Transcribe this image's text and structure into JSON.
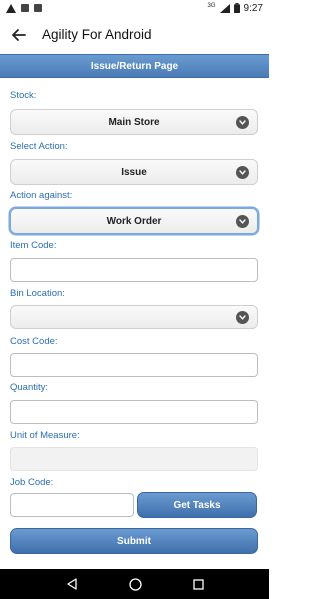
{
  "status_bar": {
    "time": "9:27",
    "signal": "3G",
    "icons": [
      "warning-icon",
      "notification-icon",
      "sd-card-icon",
      "signal-icon",
      "battery-icon"
    ]
  },
  "app_bar": {
    "title": "Agility For Android",
    "back_icon": "arrow-back-icon"
  },
  "page_header": "Issue/Return Page",
  "form": {
    "stock": {
      "label": "Stock:",
      "value": "Main Store"
    },
    "select_action": {
      "label": "Select Action:",
      "value": "Issue"
    },
    "action_against": {
      "label": "Action against:",
      "value": "Work Order"
    },
    "item_code": {
      "label": "Item Code:",
      "value": ""
    },
    "bin_location": {
      "label": "Bin Location:",
      "value": ""
    },
    "cost_code": {
      "label": "Cost Code:",
      "value": ""
    },
    "quantity": {
      "label": "Quantity:",
      "value": ""
    },
    "unit_of_measure": {
      "label": "Unit of Measure:",
      "value": ""
    },
    "job_code": {
      "label": "Job Code:",
      "value": ""
    },
    "get_tasks_label": "Get Tasks",
    "submit_label": "Submit"
  },
  "nav_bar": {
    "icons": [
      "back-triangle-icon",
      "home-circle-icon",
      "recents-square-icon"
    ]
  },
  "colors": {
    "accent": "#4a7bb5",
    "label": "#2b6fb0"
  }
}
